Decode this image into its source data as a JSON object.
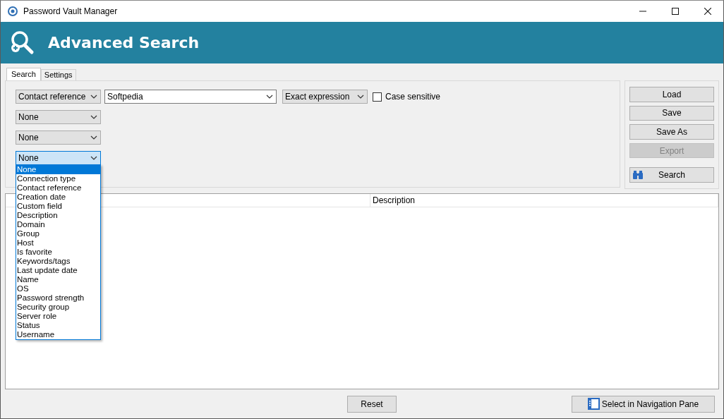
{
  "window": {
    "title": "Password Vault Manager"
  },
  "header": {
    "title": "Advanced Search"
  },
  "tabs": [
    {
      "label": "Search",
      "selected": true
    },
    {
      "label": "Settings",
      "selected": false
    }
  ],
  "criteria": [
    {
      "field": "Contact reference",
      "value": "Softpedia",
      "match": "Exact expression",
      "case_sensitive_label": "Case sensitive",
      "case_sensitive": false,
      "open": false
    },
    {
      "field": "None",
      "open": false
    },
    {
      "field": "None",
      "open": false
    },
    {
      "field": "None",
      "open": true,
      "options": [
        {
          "label": "None",
          "selected": true
        },
        {
          "label": "Connection type",
          "selected": false
        },
        {
          "label": "Contact reference",
          "selected": false
        },
        {
          "label": "Creation date",
          "selected": false
        },
        {
          "label": "Custom field",
          "selected": false
        },
        {
          "label": "Description",
          "selected": false
        },
        {
          "label": "Domain",
          "selected": false
        },
        {
          "label": "Group",
          "selected": false
        },
        {
          "label": "Host",
          "selected": false
        },
        {
          "label": "Is favorite",
          "selected": false
        },
        {
          "label": "Keywords/tags",
          "selected": false
        },
        {
          "label": "Last update date",
          "selected": false
        },
        {
          "label": "Name",
          "selected": false
        },
        {
          "label": "OS",
          "selected": false
        },
        {
          "label": "Password strength",
          "selected": false
        },
        {
          "label": "Security group",
          "selected": false
        },
        {
          "label": "Server role",
          "selected": false
        },
        {
          "label": "Status",
          "selected": false
        },
        {
          "label": "Username",
          "selected": false
        }
      ]
    }
  ],
  "side_buttons": [
    {
      "label": "Load",
      "kind": "plain",
      "disabled": false
    },
    {
      "label": "Save",
      "kind": "plain",
      "disabled": false
    },
    {
      "label": "Save As",
      "kind": "plain",
      "disabled": false
    },
    {
      "label": "Export",
      "kind": "plain",
      "disabled": true
    },
    {
      "label": "Search",
      "kind": "search",
      "disabled": false
    }
  ],
  "results": {
    "columns": [
      {},
      {
        "label": "Description"
      }
    ]
  },
  "footer_buttons": [
    {
      "label": "Reset",
      "kind": "plain"
    },
    {
      "label": "Select in Navigation Pane",
      "kind": "navigation"
    }
  ]
}
